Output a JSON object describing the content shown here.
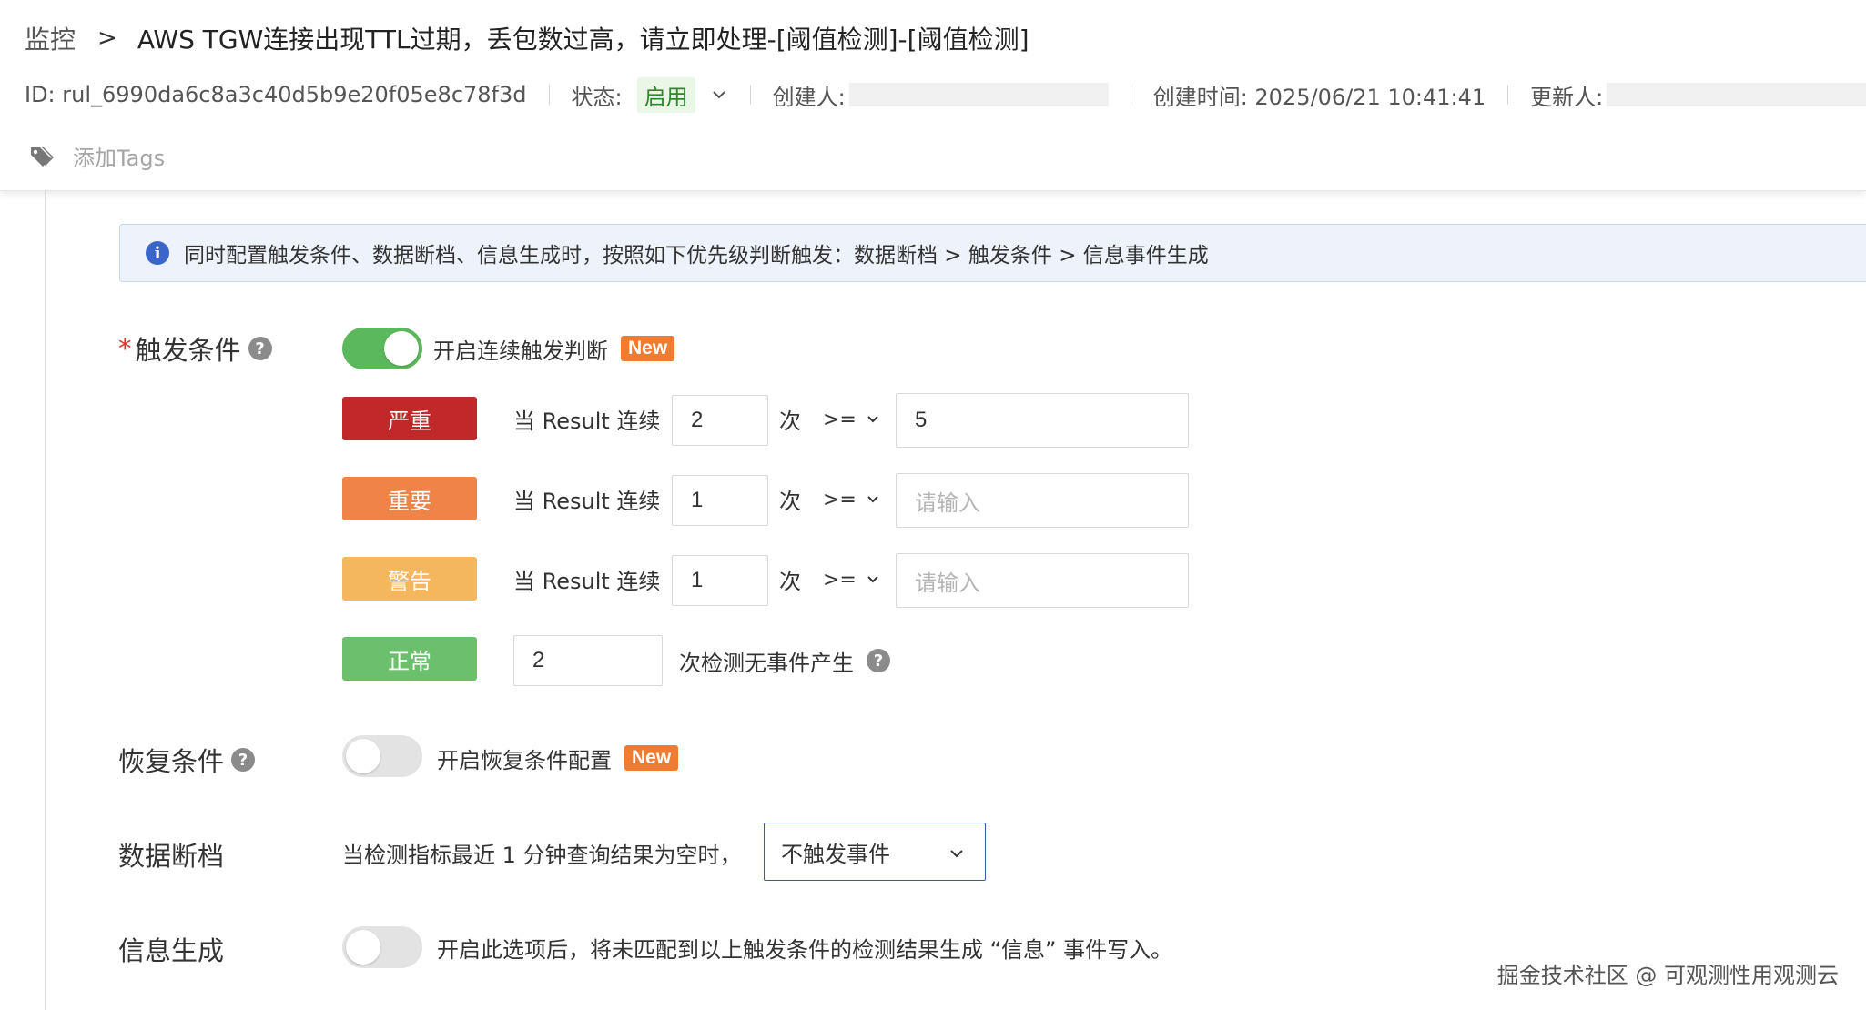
{
  "breadcrumb": {
    "root": "监控",
    "separator": ">",
    "title": "AWS TGW连接出现TTL过期，丢包数过高，请立即处理-[阈值检测]-[阈值检测]"
  },
  "meta": {
    "id": "ID: rul_6990da6c8a3c40d5b9e20f05e8c78f3d",
    "status_label": "状态:",
    "status_value": "启用",
    "creator_label": "创建人:",
    "created_time": "创建时间: 2025/06/21 10:41:41",
    "updater_label": "更新人:"
  },
  "tags": {
    "add_label": "添加Tags"
  },
  "banner": {
    "text": "同时配置触发条件、数据断档、信息生成时，按照如下优先级判断触发：数据断档 > 触发条件 > 信息事件生成"
  },
  "trigger": {
    "required_mark": "*",
    "label": "触发条件",
    "toggle_label": "开启连续触发判断",
    "new_badge": "New",
    "levels": [
      {
        "name": "严重",
        "color": "#c0282a",
        "prefix": "当 Result 连续",
        "count": "2",
        "unit": "次",
        "operator": ">=",
        "threshold": "5",
        "placeholder": ""
      },
      {
        "name": "重要",
        "color": "#f08347",
        "prefix": "当 Result 连续",
        "count": "1",
        "unit": "次",
        "operator": ">=",
        "threshold": "",
        "placeholder": "请输入"
      },
      {
        "name": "警告",
        "color": "#f5b75e",
        "prefix": "当 Result 连续",
        "count": "1",
        "unit": "次",
        "operator": ">=",
        "threshold": "",
        "placeholder": "请输入"
      }
    ],
    "normal": {
      "name": "正常",
      "color": "#6cbf6c",
      "count": "2",
      "suffix": "次检测无事件产生"
    }
  },
  "recovery": {
    "label": "恢复条件",
    "toggle_label": "开启恢复条件配置",
    "new_badge": "New"
  },
  "nodata": {
    "label": "数据断档",
    "text": "当检测指标最近 1 分钟查询结果为空时，",
    "select_value": "不触发事件"
  },
  "info": {
    "label": "信息生成",
    "text": "开启此选项后，将未匹配到以上触发条件的检测结果生成 “信息” 事件写入。"
  },
  "watermark": "掘金技术社区 @ 可观测性用观测云"
}
